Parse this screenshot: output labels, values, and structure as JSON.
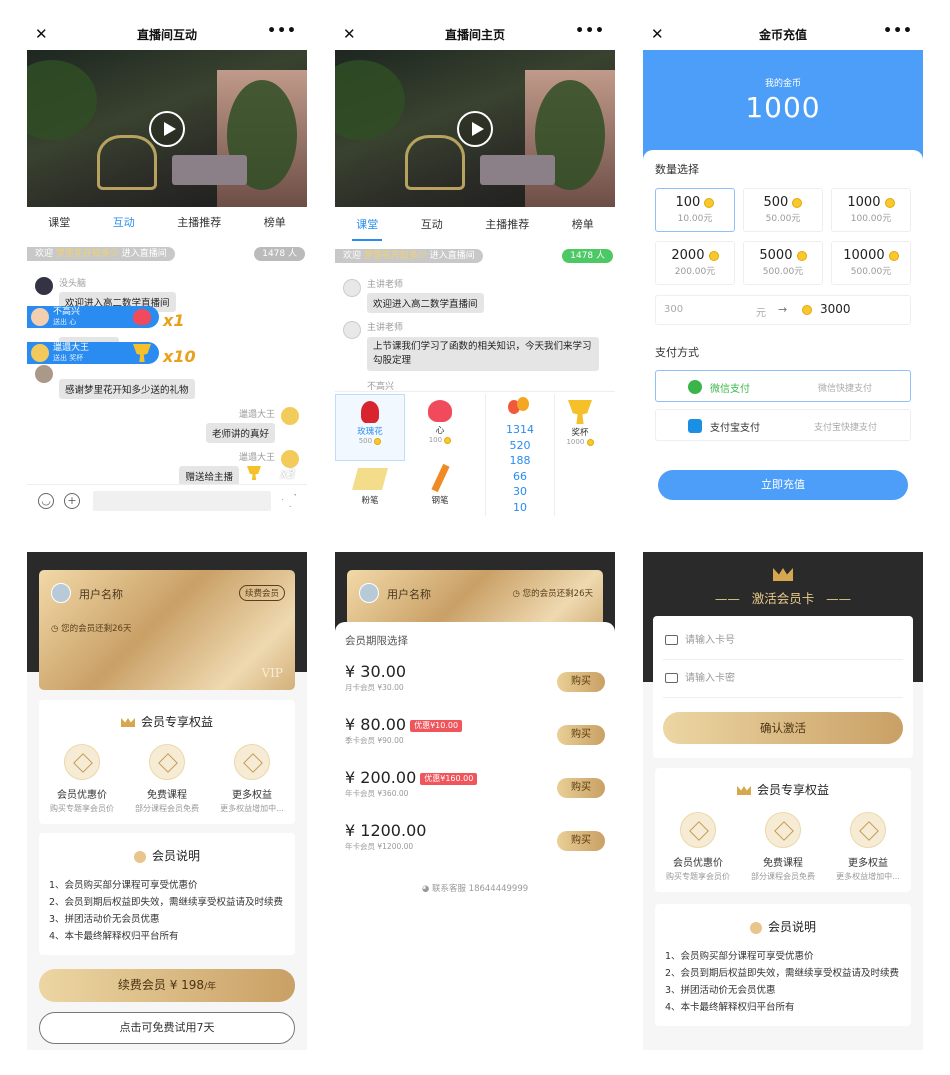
{
  "p1": {
    "title": "直播间互动",
    "tabs": [
      "课堂",
      "互动",
      "主播推荐",
      "榜单"
    ],
    "welcome_prefix": "欢迎",
    "welcome_name": "梦里花开知多少",
    "welcome_suffix": "进入直播间",
    "count": "1478 人",
    "msgs": [
      {
        "user": "没头脑",
        "text": "欢迎进入高二数学直播间"
      },
      {
        "user": "",
        "text": "赠送给主播"
      },
      {
        "user": "",
        "text": "感谢梦里花开知多少送的礼物"
      }
    ],
    "gift_banners": [
      {
        "name": "不高兴",
        "sub": "送出 心",
        "mult": "x1"
      },
      {
        "name": "邋遢大王",
        "sub": "送出 奖杯",
        "mult": "x10"
      }
    ],
    "right_msgs": [
      {
        "user": "邋遢大王",
        "text": "老师讲的真好"
      },
      {
        "user": "邋遢大王",
        "text": "赠送给主播"
      }
    ],
    "right_gift_count": "x3"
  },
  "p2": {
    "title": "直播间主页",
    "tabs": [
      "课堂",
      "互动",
      "主播推荐",
      "榜单"
    ],
    "welcome_prefix": "欢迎",
    "welcome_name": "梦里花开知多少",
    "welcome_suffix": "进入直播间",
    "count": "1478 人",
    "msgs": [
      {
        "user": "主讲老师",
        "text": "欢迎进入高二数学直播间"
      },
      {
        "user": "主讲老师",
        "text": "上节课我们学习了函数的相关知识，今天我们来学习勾股定理"
      }
    ],
    "hidden_user": "不高兴",
    "gifts": [
      {
        "name": "玫瑰花",
        "price": "500"
      },
      {
        "name": "心",
        "price": "100"
      },
      {
        "name": "奖杯",
        "price": "1000"
      },
      {
        "name": "粉笔",
        "price": ""
      },
      {
        "name": "钢笔",
        "price": ""
      }
    ],
    "qty_options": [
      "1314",
      "520",
      "188",
      "66",
      "30",
      "10"
    ]
  },
  "p3": {
    "title": "金币充值",
    "coin_label": "我的金币",
    "coin_value": "1000",
    "qty_title": "数量选择",
    "amounts": [
      {
        "a": "100",
        "p": "10.00元"
      },
      {
        "a": "500",
        "p": "50.00元"
      },
      {
        "a": "1000",
        "p": "100.00元"
      },
      {
        "a": "2000",
        "p": "200.00元"
      },
      {
        "a": "5000",
        "p": "500.00元"
      },
      {
        "a": "10000",
        "p": "500.00元"
      }
    ],
    "custom_placeholder": "300",
    "custom_unit": "元",
    "custom_arrow": "→",
    "custom_result": "3000",
    "pay_title": "支付方式",
    "pay": [
      {
        "name": "微信支付",
        "hint": "微信快捷支付"
      },
      {
        "name": "支付宝支付",
        "hint": "支付宝快捷支付"
      }
    ],
    "submit": "立即充值",
    "accent": "#4c9ef9"
  },
  "p4": {
    "username": "用户名称",
    "renew_tag": "续费会员",
    "remain": "您的会员还剩26天",
    "vip": "VIP",
    "benefits_title": "会员专享权益",
    "benefits": [
      {
        "t": "会员优惠价",
        "d": "购买专题享会员价"
      },
      {
        "t": "免费课程",
        "d": "部分课程会员免费"
      },
      {
        "t": "更多权益",
        "d": "更多权益增加中..."
      }
    ],
    "notes_title": "会员说明",
    "notes": [
      "1、会员购买部分课程可享受优惠价",
      "2、会员到期后权益即失效，需继续享受权益请及时续费",
      "3、拼团活动价无会员优惠",
      "4、本卡最终解释权归平台所有"
    ],
    "renew_btn": "续费会员 ¥ 198",
    "renew_unit": "/年",
    "trial_btn": "点击可免费试用7天"
  },
  "p5": {
    "username": "用户名称",
    "remain": "您的会员还剩26天",
    "period_title": "会员期限选择",
    "plans": [
      {
        "price": "¥ 30.00",
        "sub": "月卡会员 ¥30.00",
        "disc": ""
      },
      {
        "price": "¥ 80.00",
        "sub": "季卡会员 ¥90.00",
        "disc": "优惠¥10.00"
      },
      {
        "price": "¥ 200.00",
        "sub": "年卡会员 ¥360.00",
        "disc": "优惠¥160.00"
      },
      {
        "price": "¥ 1200.00",
        "sub": "年卡会员 ¥1200.00",
        "disc": ""
      }
    ],
    "buy": "购买",
    "contact": "联系客服 18644449999"
  },
  "p6": {
    "title": "激活会员卡",
    "card_no_placeholder": "请输入卡号",
    "card_pwd_placeholder": "请输入卡密",
    "confirm": "确认激活",
    "benefits_title": "会员专享权益",
    "benefits": [
      {
        "t": "会员优惠价",
        "d": "购买专题享会员价"
      },
      {
        "t": "免费课程",
        "d": "部分课程会员免费"
      },
      {
        "t": "更多权益",
        "d": "更多权益增加中..."
      }
    ],
    "notes_title": "会员说明",
    "notes": [
      "1、会员购买部分课程可享受优惠价",
      "2、会员到期后权益即失效，需继续享受权益请及时续费",
      "3、拼团活动价无会员优惠",
      "4、本卡最终解释权归平台所有"
    ]
  }
}
